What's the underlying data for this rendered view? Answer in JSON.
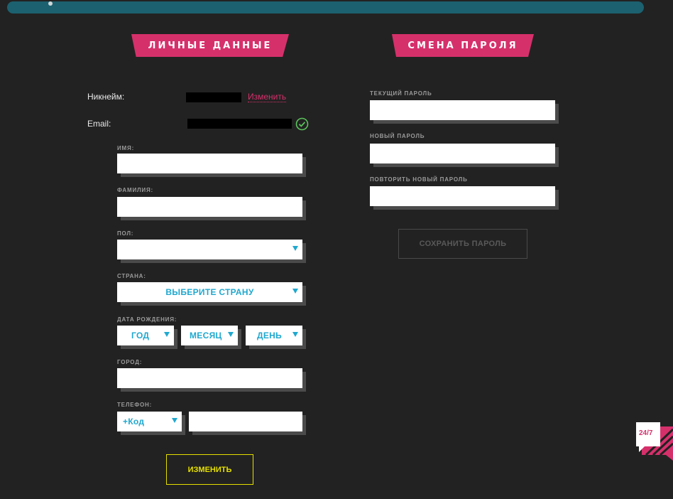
{
  "personal": {
    "title": "ЛИЧНЫЕ ДАННЫЕ",
    "nickname_label": "Никнейм:",
    "change_link": "Изменить",
    "email_label": "Email:",
    "first_name_label": "ИМЯ:",
    "last_name_label": "ФАМИЛИЯ:",
    "gender_label": "ПОЛ:",
    "gender_value": "",
    "country_label": "СТРАНА:",
    "country_value": "ВЫБЕРИТЕ СТРАНУ",
    "birthdate_label": "ДАТА РОЖДЕНИЯ:",
    "year_value": "ГОД",
    "month_value": "МЕСЯЦ",
    "day_value": "ДЕНЬ",
    "city_label": "ГОРОД:",
    "phone_label": "ТЕЛЕФОН:",
    "phone_code_value": "+Код",
    "submit_label": "ИЗМЕНИТЬ"
  },
  "password": {
    "title": "СМЕНА ПАРОЛЯ",
    "current_label": "ТЕКУЩИЙ ПАРОЛЬ",
    "new_label": "НОВЫЙ ПАРОЛЬ",
    "repeat_label": "ПОВТОРИТЬ НОВЫЙ ПАРОЛЬ",
    "save_label": "СОХРАНИТЬ ПАРОЛЬ"
  },
  "support": {
    "badge": "24/7",
    "icon": "chat-bubble-icon"
  },
  "colors": {
    "background": "#222222",
    "accent_pink": "#d6306b",
    "accent_blue": "#20a8cf",
    "accent_yellow": "#e6e000",
    "topbar": "#1c6170",
    "verified_green": "#5cc25c"
  }
}
